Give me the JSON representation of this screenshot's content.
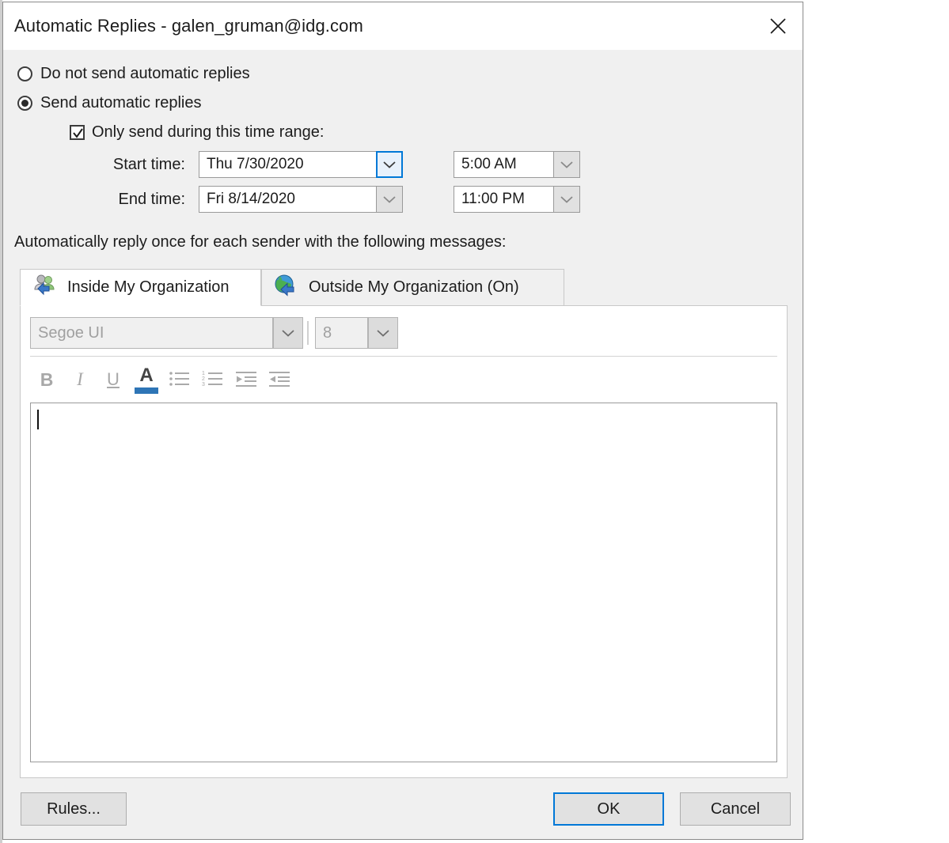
{
  "window": {
    "title": "Automatic Replies - galen_gruman@idg.com",
    "close_icon": "close-icon"
  },
  "options": {
    "do_not_send_label": "Do not send automatic replies",
    "do_not_send_checked": false,
    "send_label": "Send automatic replies",
    "send_checked": true
  },
  "time_range": {
    "checkbox_label": "Only send during this time range:",
    "checkbox_checked": true,
    "start_label": "Start time:",
    "start_date": "Thu 7/30/2020",
    "start_time": "5:00 AM",
    "end_label": "End time:",
    "end_date": "Fri 8/14/2020",
    "end_time": "11:00 PM"
  },
  "instruction": "Automatically reply once for each sender with the following messages:",
  "tabs": [
    {
      "label": "Inside My Organization",
      "icon": "people-reply-icon",
      "active": true
    },
    {
      "label": "Outside My Organization (On)",
      "icon": "globe-reply-icon",
      "active": false
    }
  ],
  "format_toolbar": {
    "font_name": "Segoe UI",
    "font_size": "8",
    "buttons": [
      {
        "name": "bold-icon",
        "label": "B"
      },
      {
        "name": "italic-icon",
        "label": "I"
      },
      {
        "name": "underline-icon",
        "label": "U"
      },
      {
        "name": "font-color-icon",
        "label": "A"
      },
      {
        "name": "bullet-list-icon",
        "label": ""
      },
      {
        "name": "numbered-list-icon",
        "label": ""
      },
      {
        "name": "decrease-indent-icon",
        "label": ""
      },
      {
        "name": "increase-indent-icon",
        "label": ""
      }
    ]
  },
  "editor": {
    "value": ""
  },
  "footer": {
    "rules_label": "Rules...",
    "ok_label": "OK",
    "cancel_label": "Cancel"
  },
  "colors": {
    "accent": "#0078d7",
    "dialog_bg": "#f0f0f0",
    "text": "#1c1c1c",
    "disabled_text": "#a0a0a0"
  }
}
